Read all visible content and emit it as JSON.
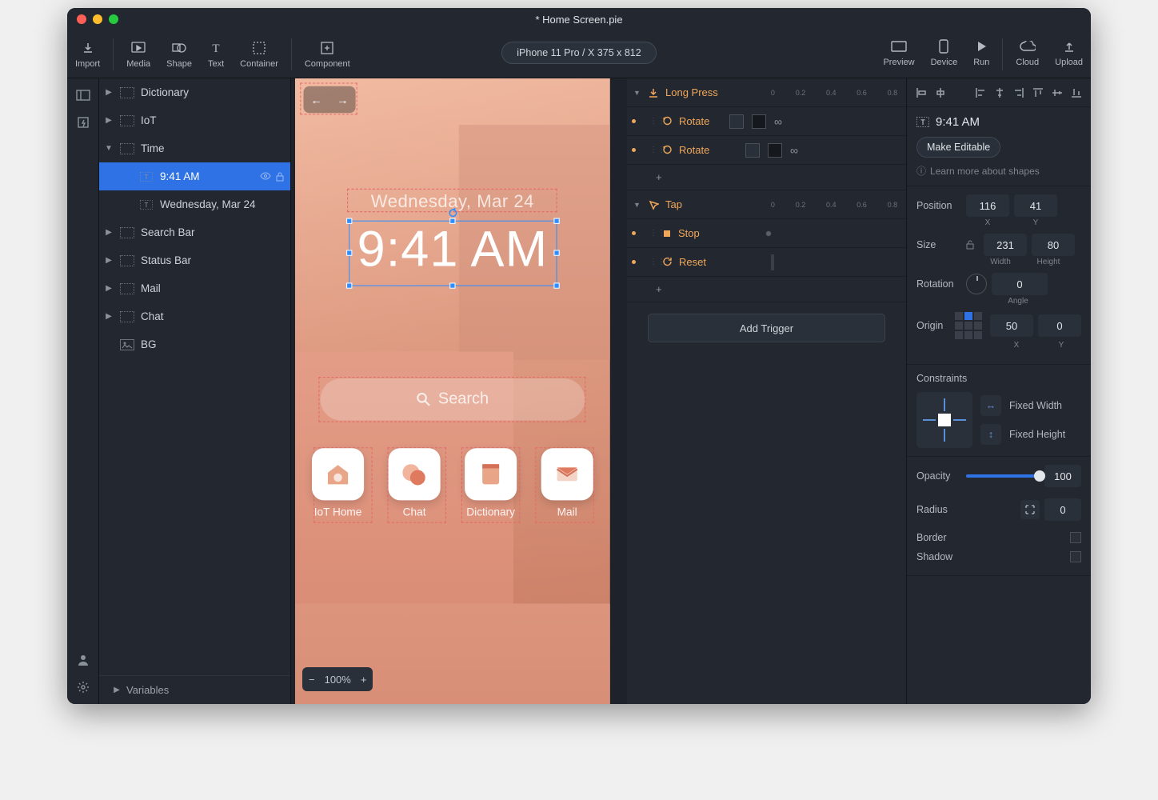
{
  "window_title": "* Home Screen.pie",
  "toolbar": {
    "import": "Import",
    "media": "Media",
    "shape": "Shape",
    "text": "Text",
    "container": "Container",
    "component": "Component",
    "preview": "Preview",
    "device": "Device",
    "run": "Run",
    "cloud": "Cloud",
    "upload": "Upload"
  },
  "device_pill": "iPhone 11 Pro / X  375 x 812",
  "layers": {
    "items": [
      {
        "label": "Dictionary",
        "type": "group",
        "expanded": false,
        "indent": 1
      },
      {
        "label": "IoT",
        "type": "group",
        "expanded": false,
        "indent": 1
      },
      {
        "label": "Time",
        "type": "group",
        "expanded": true,
        "indent": 1
      },
      {
        "label": "9:41 AM",
        "type": "text",
        "indent": 2,
        "selected": true
      },
      {
        "label": "Wednesday, Mar 24",
        "type": "text",
        "indent": 2
      },
      {
        "label": "Search Bar",
        "type": "group",
        "expanded": false,
        "indent": 1
      },
      {
        "label": "Status Bar",
        "type": "group",
        "expanded": false,
        "indent": 1
      },
      {
        "label": "Mail",
        "type": "group",
        "expanded": false,
        "indent": 1
      },
      {
        "label": "Chat",
        "type": "group",
        "expanded": false,
        "indent": 1
      },
      {
        "label": "BG",
        "type": "image",
        "indent": 1
      }
    ],
    "variables": "Variables"
  },
  "canvas": {
    "date": "Wednesday, Mar 24",
    "time": "9:41 AM",
    "search": "Search",
    "apps": [
      {
        "label": "IoT Home"
      },
      {
        "label": "Chat"
      },
      {
        "label": "Dictionary"
      },
      {
        "label": "Mail"
      }
    ],
    "zoom": "100%"
  },
  "triggers": {
    "longpress": "Long Press",
    "tap": "Tap",
    "rotate": "Rotate",
    "stop": "Stop",
    "reset": "Reset",
    "add_trigger": "Add Trigger",
    "ticks": [
      "0",
      "0.2",
      "0.4",
      "0.6",
      "0.8"
    ]
  },
  "inspector": {
    "element_name": "9:41 AM",
    "make_editable": "Make Editable",
    "learn": "Learn more about shapes",
    "position_label": "Position",
    "position_x": "116",
    "position_y": "41",
    "x": "X",
    "y": "Y",
    "size_label": "Size",
    "size_w": "231",
    "size_h": "80",
    "width": "Width",
    "height": "Height",
    "rotation_label": "Rotation",
    "rotation": "0",
    "angle": "Angle",
    "origin_label": "Origin",
    "origin_x": "50",
    "origin_y": "0",
    "constraints": "Constraints",
    "fixed_width": "Fixed Width",
    "fixed_height": "Fixed Height",
    "opacity_label": "Opacity",
    "opacity": "100",
    "radius_label": "Radius",
    "radius": "0",
    "border": "Border",
    "shadow": "Shadow"
  }
}
